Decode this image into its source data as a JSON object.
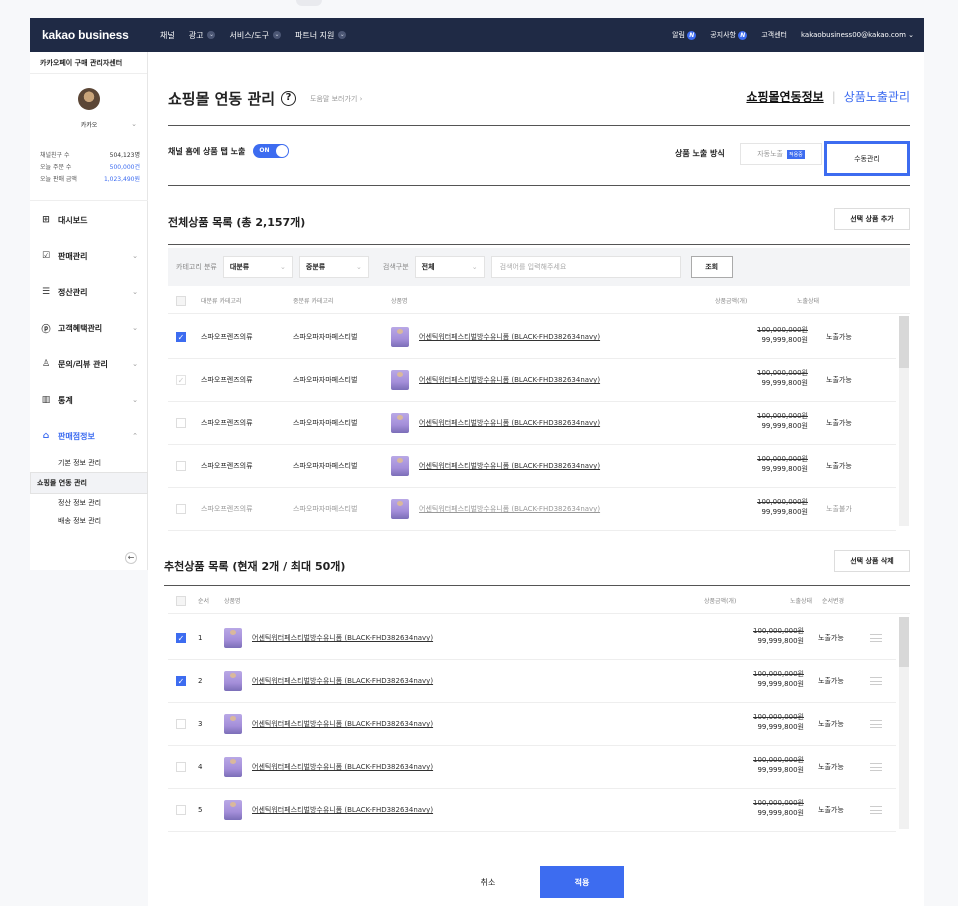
{
  "topbar": {
    "logo": "kakao business",
    "nav": [
      "채널",
      "광고",
      "서비스/도구",
      "파트너 지원"
    ],
    "alerts_label": "알림",
    "alerts_badge": "N",
    "notice_label": "공지사항",
    "notice_badge": "N",
    "support_label": "고객센터",
    "account": "kakaobusiness00@kakao.com"
  },
  "sidebar": {
    "title": "카카오페이 구매 관리자센터",
    "user_name": "카카오",
    "stats": [
      {
        "label": "채널친구 수",
        "value": "504,123명"
      },
      {
        "label": "오늘 주문 수",
        "value": "500,000건"
      },
      {
        "label": "오늘 판매 금액",
        "value": "1,023,490원"
      }
    ],
    "menu": [
      {
        "label": "대시보드",
        "icon": "dashboard-icon"
      },
      {
        "label": "판매관리",
        "icon": "clipboard-icon"
      },
      {
        "label": "정산관리",
        "icon": "database-icon"
      },
      {
        "label": "고객혜택관리",
        "icon": "coupon-icon"
      },
      {
        "label": "문의/리뷰 관리",
        "icon": "person-icon"
      },
      {
        "label": "통계",
        "icon": "chart-icon"
      },
      {
        "label": "판매점정보",
        "icon": "store-icon"
      }
    ],
    "submenu": [
      "기본 정보 관리",
      "쇼핑몰 연동 관리",
      "정산 정보 관리",
      "배송 정보 관리"
    ]
  },
  "header": {
    "title": "쇼핑몰 연동 관리",
    "help_link": "도움말 보러가기",
    "tab_info": "쇼핑몰연동정보",
    "tab_exposure": "상품노출관리"
  },
  "exposure": {
    "label": "채널 홈에 상품 탭 노출",
    "toggle": "ON",
    "method_label": "상품 노출 방식",
    "auto_label": "자동노출",
    "auto_tag": "적용중",
    "manual_label": "수동관리"
  },
  "all_products": {
    "title": "전체상품 목록 (총 2,157개)",
    "add_button": "선택 상품 추가",
    "filter": {
      "category_label": "카테고리 분류",
      "major": "대분류",
      "middle": "중분류",
      "search_type_label": "검색구분",
      "search_type": "전체",
      "search_placeholder": "검색어를 입력해주세요",
      "search_button": "조회"
    },
    "columns": [
      "대분류 카테고리",
      "중분류 카테고리",
      "상품명",
      "상품금액(개)",
      "노출상태"
    ],
    "rows": [
      {
        "major": "스파오프렌즈의류",
        "middle": "스파오파자마페스티벌",
        "name": "어센틱워터페스티벌방수유니폼 (BLACK-FHD382634navy)",
        "orig": "100,000,000원",
        "price": "99,999,800원",
        "status": "노출가능"
      },
      {
        "major": "스파오프렌즈의류",
        "middle": "스파오파자마페스티벌",
        "name": "어센틱워터페스티벌방수유니폼 (BLACK-FHD382634navy)",
        "orig": "100,000,000원",
        "price": "99,999,800원",
        "status": "노출가능"
      },
      {
        "major": "스파오프렌즈의류",
        "middle": "스파오파자마페스티벌",
        "name": "어센틱워터페스티벌방수유니폼 (BLACK-FHD382634navy)",
        "orig": "100,000,000원",
        "price": "99,999,800원",
        "status": "노출가능"
      },
      {
        "major": "스파오프렌즈의류",
        "middle": "스파오파자마페스티벌",
        "name": "어센틱워터페스티벌방수유니폼 (BLACK-FHD382634navy)",
        "orig": "100,000,000원",
        "price": "99,999,800원",
        "status": "노출가능"
      },
      {
        "major": "스파오프렌즈의류",
        "middle": "스파오파자마페스티벌",
        "name": "어센틱워터페스티벌방수유니폼 (BLACK-FHD382634navy)",
        "orig": "100,000,000원",
        "price": "99,999,800원",
        "status": "노출불가"
      }
    ]
  },
  "recommended": {
    "title": "추천상품 목록 (현재 2개 / 최대 50개)",
    "delete_button": "선택 상품 삭제",
    "columns": [
      "순서",
      "상품명",
      "상품금액(개)",
      "노출상태",
      "순서변경"
    ],
    "rows": [
      {
        "order": "1",
        "name": "어센틱워터페스티벌방수유니폼 (BLACK-FHD382634navy)",
        "orig": "100,000,000원",
        "price": "99,999,800원",
        "status": "노출가능"
      },
      {
        "order": "2",
        "name": "어센틱워터페스티벌방수유니폼 (BLACK-FHD382634navy)",
        "orig": "100,000,000원",
        "price": "99,999,800원",
        "status": "노출가능"
      },
      {
        "order": "3",
        "name": "어센틱워터페스티벌방수유니폼 (BLACK-FHD382634navy)",
        "orig": "100,000,000원",
        "price": "99,999,800원",
        "status": "노출가능"
      },
      {
        "order": "4",
        "name": "어센틱워터페스티벌방수유니폼 (BLACK-FHD382634navy)",
        "orig": "100,000,000원",
        "price": "99,999,800원",
        "status": "노출가능"
      },
      {
        "order": "5",
        "name": "어센틱워터페스티벌방수유니폼 (BLACK-FHD382634navy)",
        "orig": "100,000,000원",
        "price": "99,999,800원",
        "status": "노출가능"
      }
    ]
  },
  "footer": {
    "cancel": "취소",
    "apply": "적용"
  },
  "colors": {
    "accent": "#3d6cf0",
    "topbar": "#1f2a45"
  }
}
